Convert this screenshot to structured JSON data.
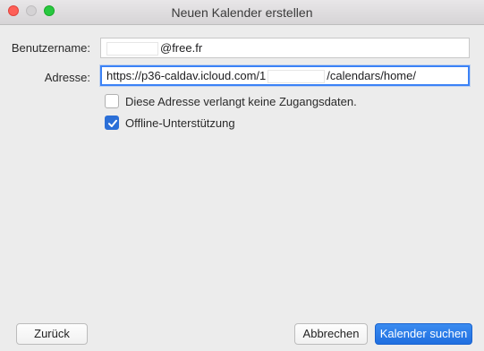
{
  "window": {
    "title": "Neuen Kalender erstellen"
  },
  "form": {
    "username_label": "Benutzername:",
    "username_suffix": "@free.fr",
    "address_label": "Adresse:",
    "address_prefix": "https://p36-caldav.icloud.com/1",
    "address_suffix": "/calendars/home/",
    "no_credentials_label": "Diese Adresse verlangt keine Zugangsdaten.",
    "no_credentials_checked": false,
    "offline_label": "Offline-Unterstützung",
    "offline_checked": true
  },
  "buttons": {
    "back": "Zurück",
    "cancel": "Abbrechen",
    "search": "Kalender suchen"
  },
  "colors": {
    "accent": "#2b6fd7",
    "close": "#fe5f57",
    "zoom": "#28c840"
  }
}
